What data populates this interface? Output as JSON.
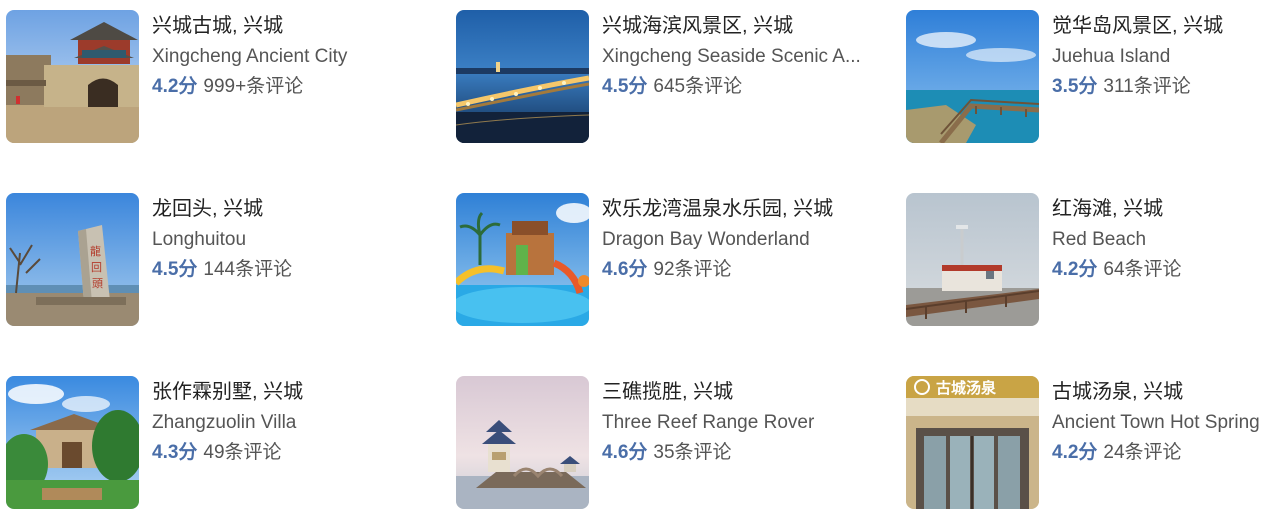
{
  "attractions": [
    {
      "name_cn": "兴城古城, 兴城",
      "name_en": "Xingcheng Ancient City",
      "rating": "4.2分",
      "reviews": "999+条评论",
      "image": "ancient-city-gate-photo"
    },
    {
      "name_cn": "兴城海滨风景区, 兴城",
      "name_en": "Xingcheng Seaside Scenic A...",
      "rating": "4.5分",
      "reviews": "645条评论",
      "image": "seaside-bridge-night-photo"
    },
    {
      "name_cn": "觉华岛风景区, 兴城",
      "name_en": "Juehua Island",
      "rating": "3.5分",
      "reviews": "311条评论",
      "image": "island-boardwalk-photo"
    },
    {
      "name_cn": "龙回头, 兴城",
      "name_en": "Longhuitou",
      "rating": "4.5分",
      "reviews": "144条评论",
      "image": "stone-monument-photo"
    },
    {
      "name_cn": "欢乐龙湾温泉水乐园, 兴城",
      "name_en": "Dragon Bay Wonderland",
      "rating": "4.6分",
      "reviews": "92条评论",
      "image": "waterpark-photo"
    },
    {
      "name_cn": "红海滩, 兴城",
      "name_en": "Red Beach",
      "rating": "4.2分",
      "reviews": "64条评论",
      "image": "red-beach-pier-photo"
    },
    {
      "name_cn": "张作霖别墅, 兴城",
      "name_en": "Zhangzuolin Villa",
      "rating": "4.3分",
      "reviews": "49条评论",
      "image": "villa-garden-photo"
    },
    {
      "name_cn": "三礁揽胜, 兴城",
      "name_en": "Three Reef Range Rover",
      "rating": "4.6分",
      "reviews": "35条评论",
      "image": "pavilion-on-reef-photo"
    },
    {
      "name_cn": "古城汤泉, 兴城",
      "name_en": "Ancient Town Hot Spring",
      "rating": "4.2分",
      "reviews": "24条评论",
      "image": "hot-spring-building-photo"
    }
  ],
  "image_text": {
    "longhuitou_stone": "龍回頭",
    "hotspring_sign": "古城汤泉"
  }
}
